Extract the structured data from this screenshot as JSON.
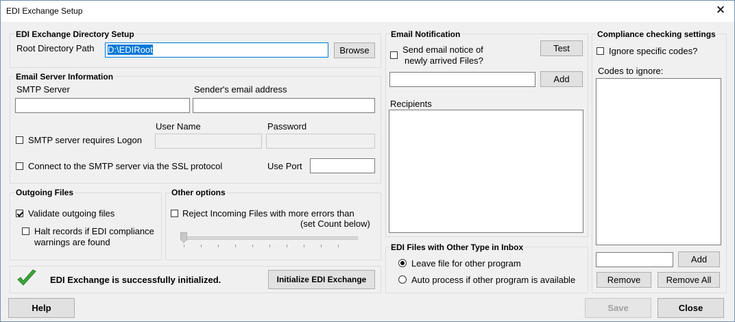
{
  "window": {
    "title": "EDI Exchange Setup",
    "close_glyph": "✕"
  },
  "directory": {
    "group_title": "EDI Exchange Directory Setup",
    "root_label": "Root Directory Path",
    "root_value": "D:\\EDIRoot",
    "browse_label": "Browse"
  },
  "email_server": {
    "group_title": "Email Server Information",
    "smtp_label": "SMTP Server",
    "smtp_value": "",
    "sender_label": "Sender's email address",
    "sender_value": "",
    "requires_logon_label": "SMTP server requires Logon",
    "username_label": "User Name",
    "password_label": "Password",
    "ssl_label": "Connect to the SMTP server via the SSL protocol",
    "port_label": "Use Port",
    "port_value": ""
  },
  "outgoing": {
    "group_title": "Outgoing Files",
    "validate_label": "Validate outgoing files",
    "halt_label_1": "Halt records if EDI compliance",
    "halt_label_2": "warnings are found"
  },
  "other_options": {
    "group_title": "Other options",
    "reject_label_1": "Reject Incoming Files with more errors than",
    "reject_label_2": "(set Count below)",
    "slider_value": 0
  },
  "status": {
    "message": "EDI Exchange is successfully initialized.",
    "init_button": "Initialize EDI Exchange",
    "icon": "check-icon",
    "icon_color": "#3aa83a"
  },
  "email_notification": {
    "group_title": "Email Notification",
    "send_label_1": "Send email notice of",
    "send_label_2": "newly arrived Files?",
    "test_label": "Test",
    "add_value": "",
    "add_label": "Add",
    "recipients_label": "Recipients"
  },
  "other_type": {
    "group_title": "EDI Files with Other Type in Inbox",
    "leave_label": "Leave file for other program",
    "auto_label": "Auto process if other program is available"
  },
  "compliance": {
    "group_title": "Compliance checking settings",
    "ignore_label": "Ignore specific codes?",
    "codes_label": "Codes to ignore:",
    "add_value": "",
    "add_label": "Add",
    "remove_label": "Remove",
    "remove_all_label": "Remove All"
  },
  "footer": {
    "help_label": "Help",
    "save_label": "Save",
    "close_label": "Close"
  },
  "colors": {
    "selection": "#0078d7",
    "border_accent": "#0078d7"
  }
}
